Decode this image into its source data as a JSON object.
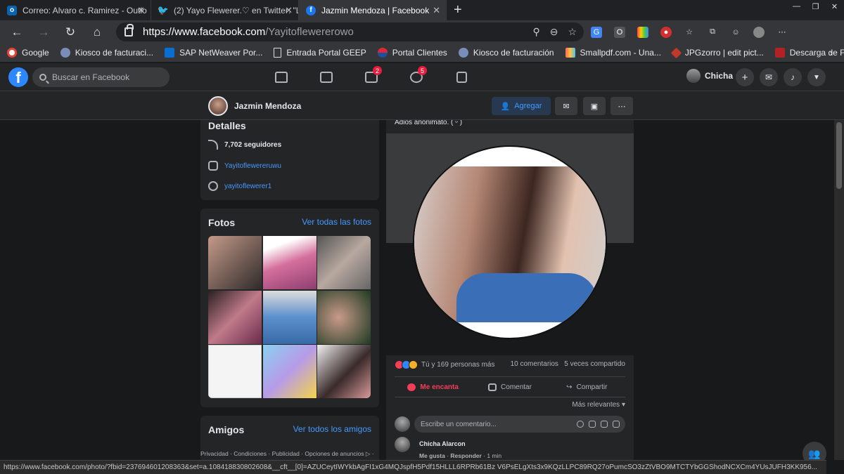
{
  "browser": {
    "tabs": [
      {
        "title": "Correo: Alvaro c. Ramirez - Outlo",
        "icon": "outlook-icon",
        "color": "#0a64ad"
      },
      {
        "title": "(2) Yayo Flewerer.♡ en Twitter: \"L",
        "icon": "twitter-icon",
        "color": "#1d9bf0"
      },
      {
        "title": "Jazmin Mendoza | Facebook",
        "icon": "facebook-icon",
        "color": "#1877f2"
      }
    ],
    "new_tab": "+",
    "url_host": "https://www.facebook.com",
    "url_path": "/Yayitoflewererowo",
    "bookmarks": [
      {
        "label": "Google",
        "color": "#ea4335"
      },
      {
        "label": "Kiosco de facturaci...",
        "color": "#7a8db8"
      },
      {
        "label": "SAP NetWeaver Por...",
        "color": "#0a6ed1"
      },
      {
        "label": "Entrada Portal GEEP",
        "color": "#dddddd"
      },
      {
        "label": "Portal Clientes",
        "color": "#e32636"
      },
      {
        "label": "Kiosco de facturación",
        "color": "#7a8db8"
      },
      {
        "label": "Smallpdf.com - Una...",
        "color": "#ff6b5a"
      },
      {
        "label": "JPGzorro | edit pict...",
        "color": "#c0392b"
      },
      {
        "label": "Descarga de Factur...",
        "color": "#b22222"
      }
    ],
    "status_url": "https://www.facebook.com/photo/?fbid=237694601208363&set=a.108418830802608&__cft__[0]=AZUCeytIWYkbAgFI1xG4MQJspfH5Pdf15HLLL6RPRb61Bz V6PsELgXts3x9KQzLLPC89RQ27oPumcSO3zZtVBO9MTCTYbGGShodNCXCm4YUsJUFH3KK956..."
  },
  "facebook": {
    "search_placeholder": "Buscar en Facebook",
    "badges": {
      "marketplace": "2",
      "groups": "5"
    },
    "user_name": "Chicha"
  },
  "profile": {
    "name": "Jazmin Mendoza",
    "add_label": "Agregar"
  },
  "details": {
    "title": "Detalles",
    "followers": "7,702 seguidores",
    "instagram": "Yayitoflewereruwu",
    "twitter": "yayitoflewerer1"
  },
  "photos": {
    "title": "Fotos",
    "see_all": "Ver todas las fotos",
    "thumbs": [
      "#7a5a50",
      "#b76c8f",
      "#8a8a8a",
      "#6e4b5a",
      "#5a7fa8",
      "#3f5e3f",
      "#e8e8e8",
      "#a68bd6",
      "#4a3a3a"
    ]
  },
  "friends": {
    "title": "Amigos",
    "see_all": "Ver todos los amigos"
  },
  "footer": "Privacidad · Condiciones · Publicidad · Opciones de anuncios ▷ ·",
  "post": {
    "caption": "Adiós anonimato. ( ᵕ̈ )",
    "reactions_text": "Tú y 169 personas más",
    "comments_count": "10 comentarios",
    "shares_count": "5 veces compartido",
    "like_label": "Me encanta",
    "comment_label": "Comentar",
    "share_label": "Compartir",
    "sort_label": "Más relevantes",
    "comment_placeholder": "Escribe un comentario...",
    "comment": {
      "author": "Chicha Alarcon",
      "like": "Me gusta",
      "reply": "Responder",
      "time": "1 min"
    }
  }
}
